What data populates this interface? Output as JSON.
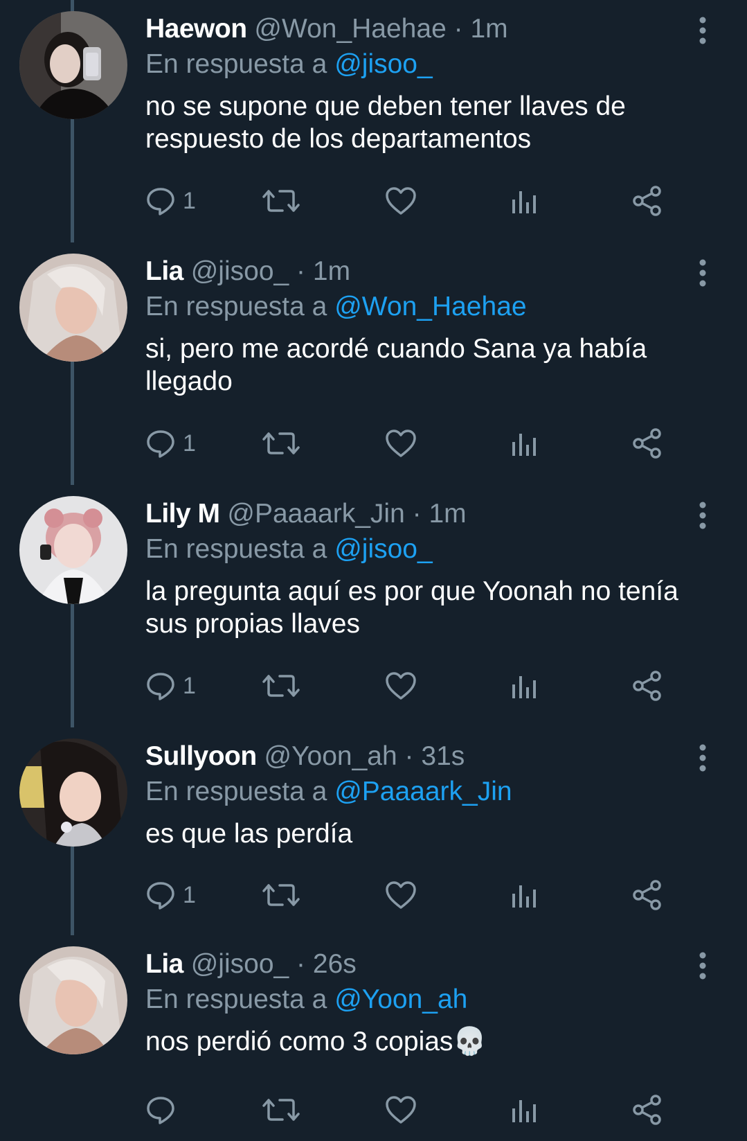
{
  "reply_prefix": "En respuesta a",
  "tweets": [
    {
      "name": "Haewon",
      "handle": "@Won_Haehae",
      "time": "1m",
      "reply_to": "@jisoo_",
      "text": "no se supone que deben tener llaves de respuesto de los departamentos",
      "reply_count": "1",
      "avatar_icon": "avatar-photo"
    },
    {
      "name": "Lia",
      "handle": "@jisoo_",
      "time": "1m",
      "reply_to": "@Won_Haehae",
      "text": "si, pero me acordé cuando Sana ya había llegado",
      "reply_count": "1",
      "avatar_icon": "avatar-photo"
    },
    {
      "name": "Lily M",
      "handle": "@Paaaark_Jin",
      "time": "1m",
      "reply_to": "@jisoo_",
      "text": "la pregunta aquí es por que Yoonah no tenía sus propias llaves",
      "reply_count": "1",
      "avatar_icon": "avatar-photo"
    },
    {
      "name": "Sullyoon",
      "handle": "@Yoon_ah",
      "time": "31s",
      "reply_to": "@Paaaark_Jin",
      "text": "es que las perdía",
      "reply_count": "1",
      "avatar_icon": "avatar-photo"
    },
    {
      "name": "Lia",
      "handle": "@jisoo_",
      "time": "26s",
      "reply_to": "@Yoon_ah",
      "text": "nos perdió como 3 copias💀",
      "reply_count": "",
      "avatar_icon": "avatar-photo"
    }
  ],
  "colors": {
    "background": "#15202b",
    "secondary_text": "#8899a6",
    "mention": "#1da1f2",
    "thread_line": "#3d5466"
  },
  "icons": [
    "reply-icon",
    "retweet-icon",
    "like-icon",
    "analytics-icon",
    "share-icon",
    "more-options-icon"
  ]
}
